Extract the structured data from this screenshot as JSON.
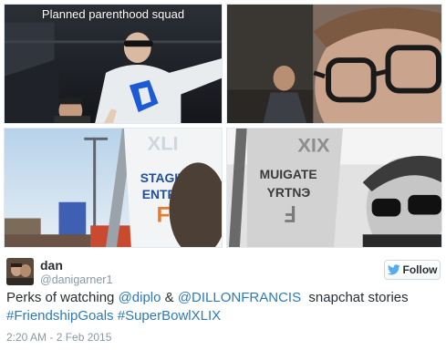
{
  "photos": {
    "photo1_caption": "Planned parenthood squad",
    "photo3_sign": [
      "STAGIT",
      "ENTR"
    ],
    "photo4_sign": [
      "MUIGATE",
      "YRTNЭ"
    ]
  },
  "author": {
    "display_name": "dan",
    "username": "@danigarner1"
  },
  "follow": {
    "label": "Follow"
  },
  "tweet": {
    "text_1": "Perks of watching ",
    "mention_1": "@diplo",
    "text_2": " & ",
    "mention_2": "@DILLONFRANCIS",
    "text_3": "  snapchat stories",
    "hashtag_1": "#FriendshipGoals",
    "hashtag_2": "#SuperBowlXLIX"
  },
  "timestamp": "2:20 AM - 2 Feb 2015",
  "colors": {
    "link": "#2b7bb9",
    "muted": "#8899a6",
    "text": "#292f33",
    "twitter_blue": "#55acee"
  }
}
